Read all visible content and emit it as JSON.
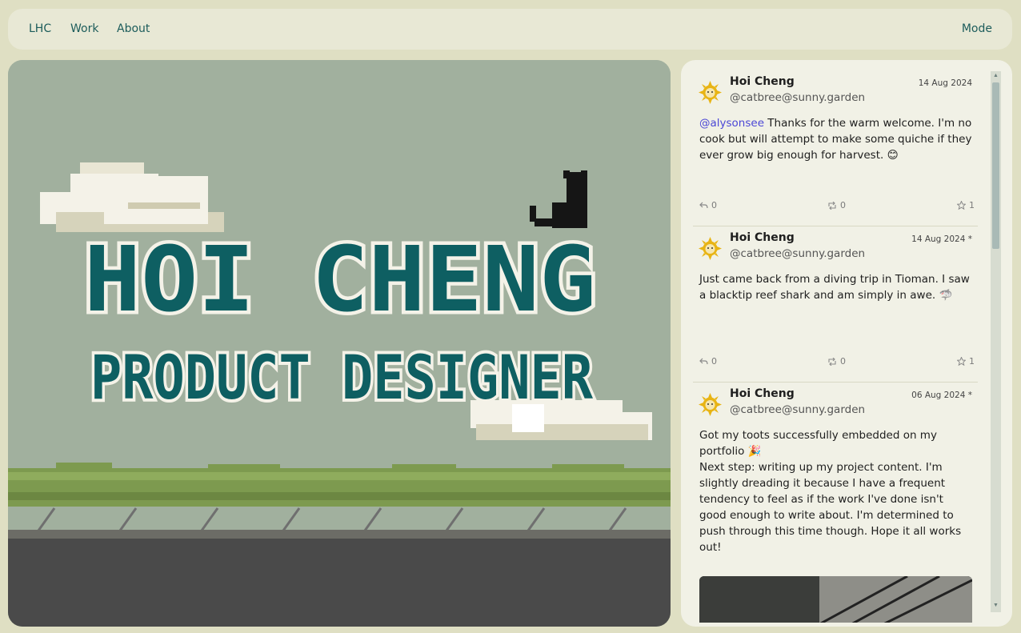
{
  "nav": {
    "brand": "LHC",
    "links": [
      "Work",
      "About"
    ],
    "mode": "Mode"
  },
  "hero": {
    "name": "HOI CHENG",
    "role": "PRODUCT DESIGNER",
    "colors": {
      "sky": "#a1b09e",
      "text": "#0e5f62",
      "outline": "#f4f2e8",
      "road": "#4a4a4a",
      "hedge": "#7d9a4f"
    }
  },
  "feed": {
    "toots": [
      {
        "name": "Hoi Cheng",
        "handle": "@catbree@sunny.garden",
        "date": "14 Aug 2024",
        "mention": "@alysonsee",
        "text": " Thanks for the warm welcome. I'm no cook but will attempt to make some quiche if they ever grow big enough for harvest. 😊",
        "replies": "0",
        "boosts": "0",
        "favs": "1"
      },
      {
        "name": "Hoi Cheng",
        "handle": "@catbree@sunny.garden",
        "date": "14 Aug 2024 *",
        "mention": "",
        "text": "Just came back from a diving trip in Tioman. I saw a blacktip reef shark and am simply in awe. 🦈",
        "replies": "0",
        "boosts": "0",
        "favs": "1"
      },
      {
        "name": "Hoi Cheng",
        "handle": "@catbree@sunny.garden",
        "date": "06 Aug 2024 *",
        "mention": "",
        "text": "Got my toots successfully embedded on my portfolio 🎉\nNext step: writing up my project content. I'm slightly dreading it because I have a frequent tendency to feel as if the work I've done isn't good enough to write about. I'm determined to push through this time though. Hope it all works out!",
        "replies": "",
        "boosts": "",
        "favs": ""
      }
    ]
  }
}
